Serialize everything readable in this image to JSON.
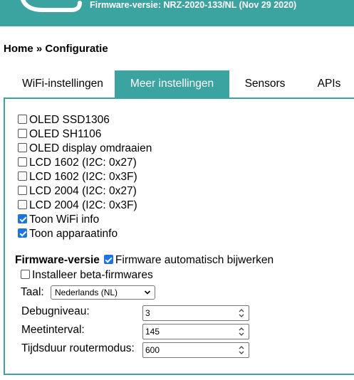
{
  "header": {
    "firmware": "Firmware-versie: NRZ-2020-133/NL (Nov 29 2020)",
    "color": "#3ba3a0"
  },
  "breadcrumb": "Home » Configuratie",
  "tabs": [
    {
      "label": "WiFi-instellingen",
      "active": false
    },
    {
      "label": "Meer instellingen",
      "active": true
    },
    {
      "label": "Sensors",
      "active": false
    },
    {
      "label": "APIs",
      "active": false
    }
  ],
  "display_options": [
    {
      "label": "OLED SSD1306",
      "checked": false
    },
    {
      "label": "OLED SH1106",
      "checked": false
    },
    {
      "label": "OLED display omdraaien",
      "checked": false
    },
    {
      "label": "LCD 1602 (I2C: 0x27)",
      "checked": false
    },
    {
      "label": "LCD 1602 (I2C: 0x3F)",
      "checked": false
    },
    {
      "label": "LCD 2004 (I2C: 0x27)",
      "checked": false
    },
    {
      "label": "LCD 2004 (I2C: 0x3F)",
      "checked": false
    },
    {
      "label": "Toon WiFi info",
      "checked": true
    },
    {
      "label": "Toon apparaatinfo",
      "checked": true
    }
  ],
  "firmware_section": {
    "title": "Firmware-versie",
    "auto_update_label": "Firmware automatisch bijwerken",
    "auto_update_checked": true,
    "beta_label": "Installeer beta-firmwares",
    "beta_checked": false
  },
  "language": {
    "label": "Taal:",
    "selected": "Nederlands (NL)"
  },
  "fields": {
    "debug_label": "Debugniveau:",
    "debug_value": "3",
    "interval_label": "Meetinterval:",
    "interval_value": "145",
    "router_label": "Tijdsduur routermodus:",
    "router_value": "600"
  },
  "colors": {
    "accent": "#3ba3a0",
    "checkbox": "#1a73e8"
  }
}
